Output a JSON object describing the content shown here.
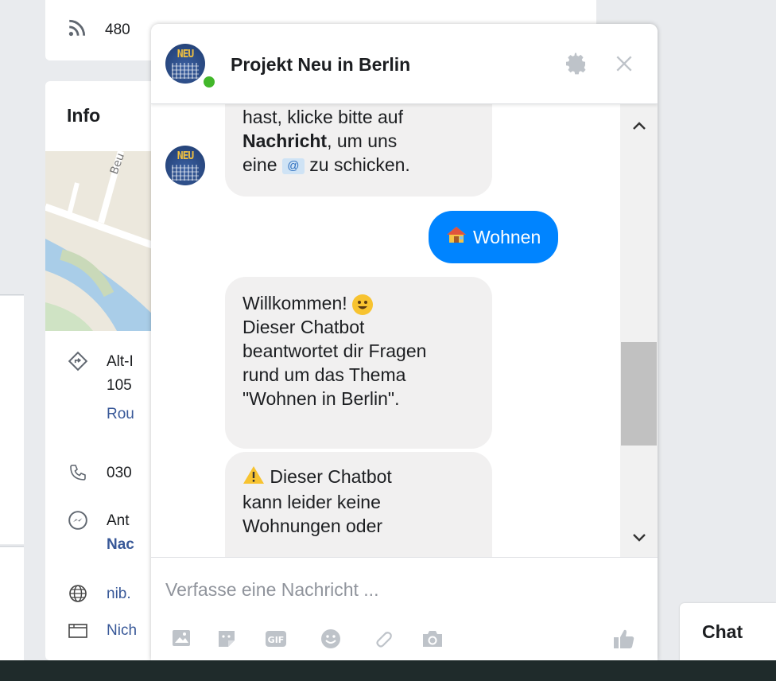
{
  "page": {
    "rss_count": "480",
    "info_title": "Info",
    "map_street": "Beu",
    "address_line1": "Alt-I",
    "address_line2": "105",
    "route_link": "Rou",
    "phone": "030",
    "messenger_line1": "Ant",
    "messenger_line2": "Nac",
    "website": "nib.",
    "hours": "Nich"
  },
  "chat_tab": {
    "label": "Chat"
  },
  "chat": {
    "title": "Projekt Neu in Berlin",
    "avatar_text": "NEU",
    "messages": {
      "partial_top_line1": "hast, klicke bitte auf",
      "partial_top_bold": "Nachricht",
      "partial_top_line2_rest": ", um uns",
      "partial_top_line3a": "eine",
      "partial_top_line3b": "zu schicken.",
      "sent_label": "Wohnen",
      "welcome_line1": "Willkommen!",
      "welcome_line2": "Dieser Chatbot",
      "welcome_line3": "beantwortet dir Fragen",
      "welcome_line4": "rund um das Thema",
      "welcome_line5": "\"Wohnen in Berlin\".",
      "warn_line1": "Dieser Chatbot",
      "warn_line2": "kann leider keine",
      "warn_line3": "Wohnungen oder"
    },
    "composer": {
      "placeholder": "Verfasse eine Nachricht ..."
    }
  },
  "colors": {
    "messenger_blue": "#0084ff",
    "online_green": "#42b72a",
    "link_blue": "#385898"
  }
}
